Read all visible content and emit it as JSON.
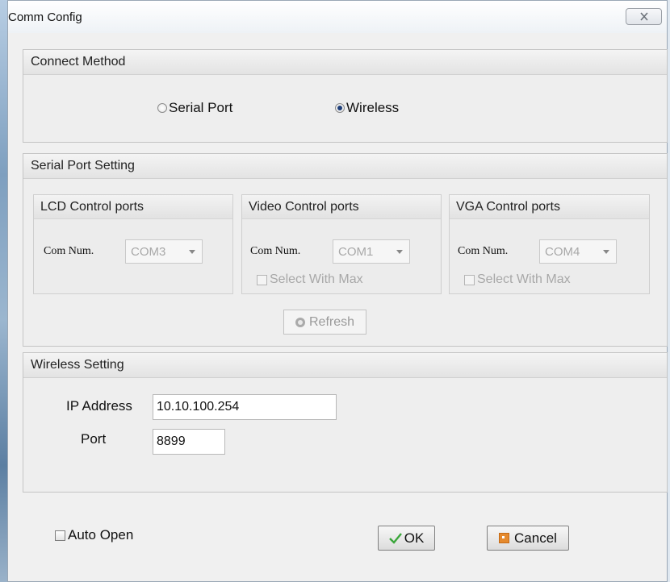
{
  "window": {
    "title": "Comm Config"
  },
  "connect_method": {
    "header": "Connect Method",
    "options": [
      {
        "label": "Serial Port",
        "selected": false
      },
      {
        "label": "Wireless",
        "selected": true
      }
    ]
  },
  "serial": {
    "header": "Serial Port Setting",
    "groups": [
      {
        "header": "LCD Control ports",
        "com_label": "Com Num.",
        "com_value": "COM3"
      },
      {
        "header": "Video Control ports",
        "com_label": "Com Num.",
        "com_value": "COM1",
        "checkbox": "Select With Max"
      },
      {
        "header": "VGA Control ports",
        "com_label": "Com Num.",
        "com_value": "COM4",
        "checkbox": "Select With Max"
      }
    ],
    "refresh_label": "Refresh"
  },
  "wireless": {
    "header": "Wireless Setting",
    "ip_label": "IP Address",
    "ip_value": "10.10.100.254",
    "port_label": "Port",
    "port_value": "8899"
  },
  "footer": {
    "auto_open_label": "Auto Open",
    "ok_label": "OK",
    "cancel_label": "Cancel"
  },
  "icons": {
    "close": "close-icon",
    "ok": "checkmark-icon",
    "cancel": "cancel-icon",
    "refresh": "refresh-icon"
  },
  "colors": {
    "ok_check": "#3aa63a",
    "cancel_icon": "#e58a2e"
  }
}
